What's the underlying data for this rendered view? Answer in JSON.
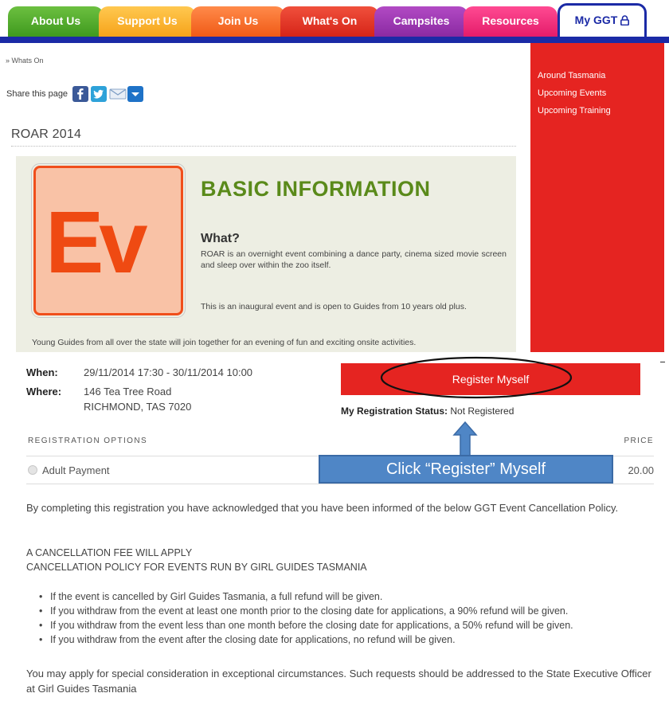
{
  "nav": {
    "tabs": [
      {
        "label": "About Us"
      },
      {
        "label": "Support Us"
      },
      {
        "label": "Join Us"
      },
      {
        "label": "What's On"
      },
      {
        "label": "Campsites"
      },
      {
        "label": "Resources"
      },
      {
        "label": "My GGT",
        "icon": "lock-icon"
      }
    ]
  },
  "breadcrumb": {
    "text": "» Whats On"
  },
  "share": {
    "label": "Share this page",
    "buttons": [
      "facebook-icon",
      "twitter-icon",
      "email-icon",
      "more-icon"
    ]
  },
  "sidebar": {
    "items": [
      {
        "label": "Around Tasmania"
      },
      {
        "label": "Upcoming Events"
      },
      {
        "label": "Upcoming Training"
      }
    ]
  },
  "page_title": "ROAR 2014",
  "info": {
    "logo_text": "Ev",
    "heading": "BASIC INFORMATION",
    "what_heading": "What?",
    "what_text": "ROAR is an overnight event combining a dance party, cinema sized movie screen and sleep over within the zoo itself.",
    "inaugural_text": "This is an inaugural event and is open to Guides from 10 years old plus.",
    "young_text": "Young Guides from all over the state will join together for an evening of fun and exciting onsite activities."
  },
  "details": {
    "when_label": "When:",
    "when_value": "29/11/2014 17:30 - 30/11/2014 10:00",
    "where_label": "Where:",
    "where_line1": "146 Tea Tree Road",
    "where_line2": "RICHMOND, TAS 7020"
  },
  "registration": {
    "button_label": "Register Myself",
    "status_label": "My Registration Status:",
    "status_value": " Not Registered",
    "options_header": "REGISTRATION OPTIONS",
    "price_header": "PRICE",
    "options": [
      {
        "name": "Adult Payment",
        "price": "20.00"
      }
    ]
  },
  "callout": {
    "text": "Click “Register” Myself"
  },
  "policy": {
    "intro": "By completing this registration you have acknowledged that you have been informed of the below GGT Event Cancellation Policy.",
    "fee_line": "A CANCELLATION FEE WILL APPLY",
    "policy_title": "CANCELLATION POLICY FOR EVENTS RUN BY GIRL GUIDES TASMANIA",
    "items": [
      "If the event is cancelled by Girl Guides Tasmania, a full refund will be given.",
      "If you withdraw from the event at least one month prior to the closing date for applications, a 90% refund will be given.",
      "If you withdraw from the event less than one month before the closing date for applications, a 50% refund will be given.",
      "If you withdraw from the event after the closing date for applications, no refund will be given."
    ],
    "closing": "You may apply for special consideration in exceptional circumstances. Such requests should be addressed to the State Executive Officer at Girl Guides Tasmania"
  },
  "colors": {
    "sidebar_red": "#e52421",
    "nav_blue": "#1b2aa6",
    "heading_green": "#5a8a1a",
    "logo_orange": "#ef4a12",
    "callout_blue": "#4f86c6"
  }
}
